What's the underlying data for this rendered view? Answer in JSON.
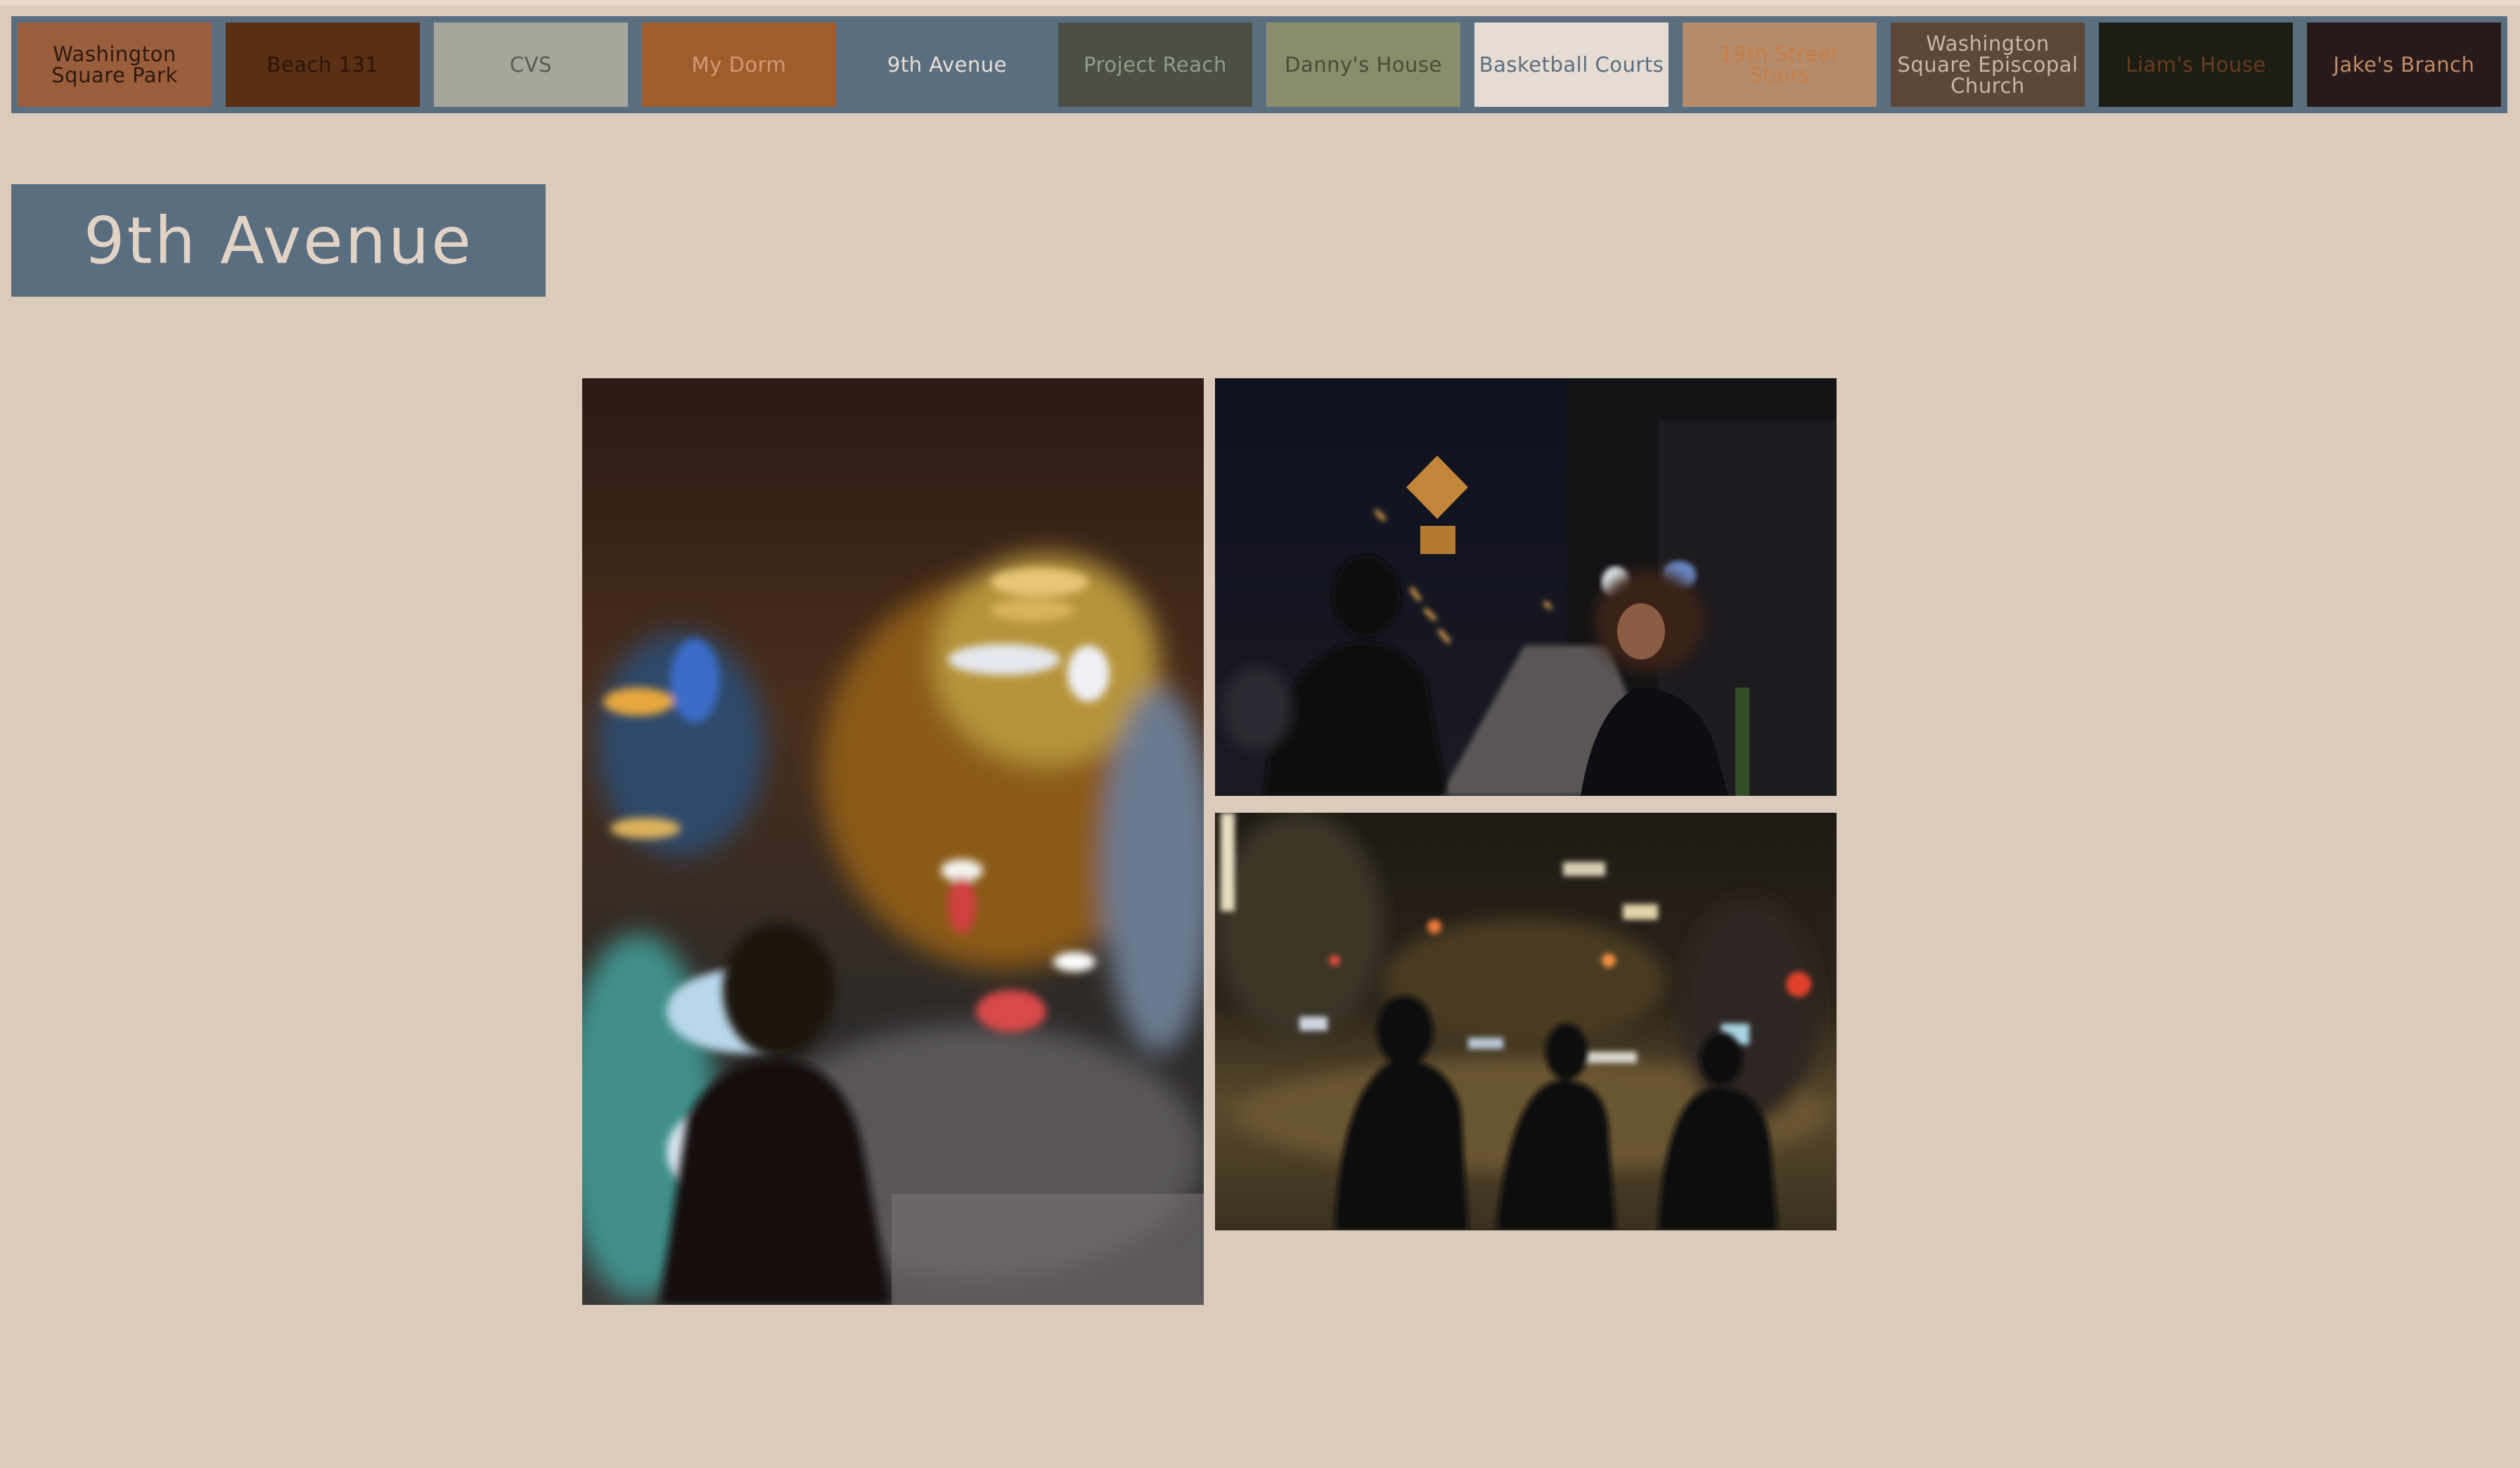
{
  "nav": {
    "items": [
      {
        "label": "Washington Square Park",
        "bg": "#9b5e3c",
        "fg": "#2b1a10"
      },
      {
        "label": "Beach 131",
        "bg": "#5a2f14",
        "fg": "#2a1508"
      },
      {
        "label": "CVS",
        "bg": "#a4a79a",
        "fg": "#5a5a52"
      },
      {
        "label": "My Dorm",
        "bg": "#a15c2c",
        "fg": "#d39a74"
      },
      {
        "label": "9th Avenue",
        "bg": "#5a6e81",
        "fg": "#eadfd4",
        "active": true
      },
      {
        "label": "Project Reach",
        "bg": "#4b4f44",
        "fg": "#949d8a"
      },
      {
        "label": "Danny's House",
        "bg": "#8a8d6c",
        "fg": "#4a4b38"
      },
      {
        "label": "Basketball Courts",
        "bg": "#e6dcd2",
        "fg": "#5a6e81"
      },
      {
        "label": "19th Street Stairs",
        "bg": "#b48c6c",
        "fg": "#c77d44"
      },
      {
        "label": "Washington Square Episcopal Church",
        "bg": "#5d4838",
        "fg": "#cbb6a3"
      },
      {
        "label": "Liam's House",
        "bg": "#1c1e14",
        "fg": "#6a3a1c"
      },
      {
        "label": "Jake's Branch",
        "bg": "#281a1a",
        "fg": "#c08c64"
      }
    ]
  },
  "page": {
    "title": "9th Avenue"
  },
  "gallery": {
    "photos": [
      {
        "name": "blurred-city-lights-photo"
      },
      {
        "name": "street-night-figures-photo"
      },
      {
        "name": "intersection-night-silhouettes-photo"
      }
    ]
  }
}
